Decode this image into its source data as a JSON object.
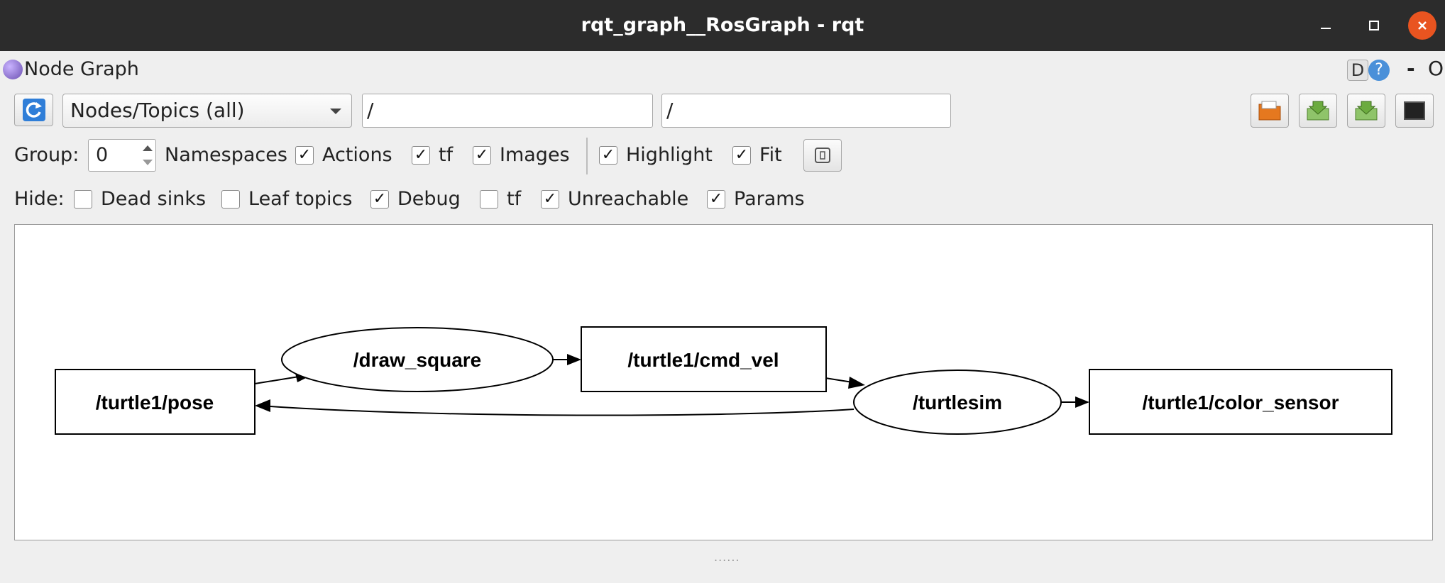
{
  "window": {
    "title": "rqt_graph__RosGraph - rqt"
  },
  "panel": {
    "title": "Node Graph",
    "d_label": "D",
    "help_label": "?",
    "dash_label": "-",
    "o_label": "O"
  },
  "toolbar": {
    "combo_value": "Nodes/Topics (all)",
    "filter1_value": "/",
    "filter2_value": "/"
  },
  "group_row": {
    "group_label": "Group:",
    "group_value": "0",
    "namespaces_label": "Namespaces",
    "actions": {
      "label": "Actions",
      "checked": true
    },
    "tf": {
      "label": "tf",
      "checked": true
    },
    "images": {
      "label": "Images",
      "checked": true
    },
    "highlight": {
      "label": "Highlight",
      "checked": true
    },
    "fit": {
      "label": "Fit",
      "checked": true
    }
  },
  "hide_row": {
    "hide_label": "Hide:",
    "dead_sinks": {
      "label": "Dead sinks",
      "checked": false
    },
    "leaf_topics": {
      "label": "Leaf topics",
      "checked": false
    },
    "debug": {
      "label": "Debug",
      "checked": true
    },
    "tf": {
      "label": "tf",
      "checked": false
    },
    "unreachable": {
      "label": "Unreachable",
      "checked": true
    },
    "params": {
      "label": "Params",
      "checked": true
    }
  },
  "check_glyph": "✓",
  "graph": {
    "nodes": {
      "pose": "/turtle1/pose",
      "draw_square": "/draw_square",
      "cmd_vel": "/turtle1/cmd_vel",
      "turtlesim": "/turtlesim",
      "color_sensor": "/turtle1/color_sensor"
    }
  },
  "colors": {
    "titlebar": "#2c2c2c",
    "close": "#e95420",
    "help": "#4a90d9"
  }
}
